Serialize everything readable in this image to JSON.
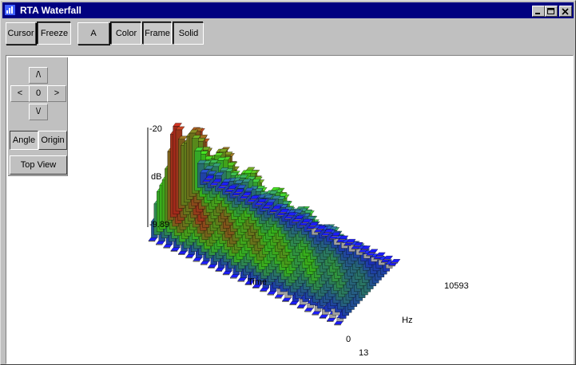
{
  "window": {
    "title": "RTA Waterfall",
    "controls": {
      "minimize": "_",
      "maximize": "□",
      "close": "×"
    }
  },
  "toolbar": {
    "cursor_label": "Cursor",
    "freeze_label": "Freeze",
    "a_label": "A",
    "color_label": "Color",
    "frame_label": "Frame",
    "solid_label": "Solid"
  },
  "nav": {
    "up_label": "/\\",
    "left_label": "<",
    "center_label": "0",
    "right_label": ">",
    "down_label": "\\/",
    "angle_label": "Angle",
    "origin_label": "Origin",
    "top_view_label": "Top View"
  },
  "plot": {
    "z_max_label": "-20",
    "z_unit_label": "dB",
    "z_min_label": "-9.89",
    "time_label": "Time",
    "time_zero_label": "0",
    "time_end_label": "13",
    "freq_label": "Hz",
    "freq_max_label": "10593"
  },
  "colors": {
    "title_bar": "#000080",
    "surface_low": "#1a1aff",
    "surface_mid": "#40d020",
    "surface_high": "#c03020",
    "shadow_gray": "#a0a0a0"
  }
}
